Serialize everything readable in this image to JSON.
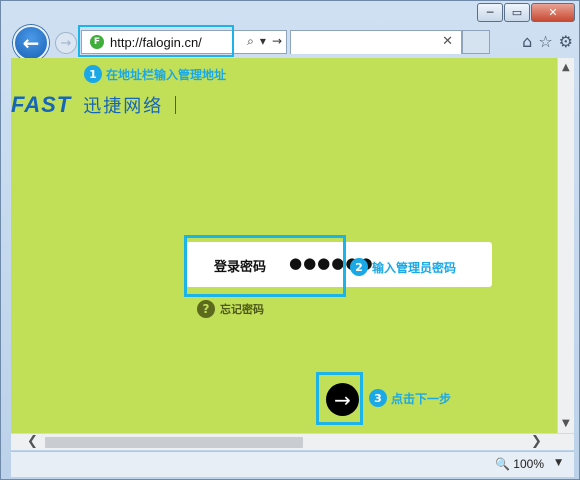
{
  "window": {
    "min_glyph": "─",
    "max_glyph": "▭",
    "close_glyph": "✕"
  },
  "nav": {
    "back_glyph": "←",
    "forward_glyph": "→",
    "url": "http://falogin.cn/",
    "favicon_letter": "F",
    "search_glyph": "⌕",
    "dropdown_glyph": "▾",
    "go_glyph": "→",
    "tab_close_glyph": "✕",
    "home_glyph": "⌂",
    "favorites_glyph": "☆",
    "tools_glyph": "⚙"
  },
  "page": {
    "background_color": "#c2df58",
    "brand": {
      "logo": "FAST",
      "name": "迅捷网络",
      "separator": "|"
    },
    "password": {
      "label": "登录密码",
      "value": "●●●●●●"
    },
    "forgot": {
      "icon": "?",
      "label": "忘记密码"
    },
    "submit_glyph": "→"
  },
  "annotations": [
    {
      "number": "1",
      "text": "在地址栏输入管理地址"
    },
    {
      "number": "2",
      "text": "输入管理员密码"
    },
    {
      "number": "3",
      "text": "点击下一步"
    }
  ],
  "status": {
    "zoom_icon": "🔍",
    "zoom": "100%",
    "zoom_dropdown": "▼"
  },
  "scrollbars": {
    "up": "▲",
    "down": "▼",
    "left": "❮",
    "right": "❯"
  },
  "colors": {
    "accent": "#1aa9e6",
    "brand_blue": "#1565b8",
    "page_bg": "#c2df58"
  }
}
